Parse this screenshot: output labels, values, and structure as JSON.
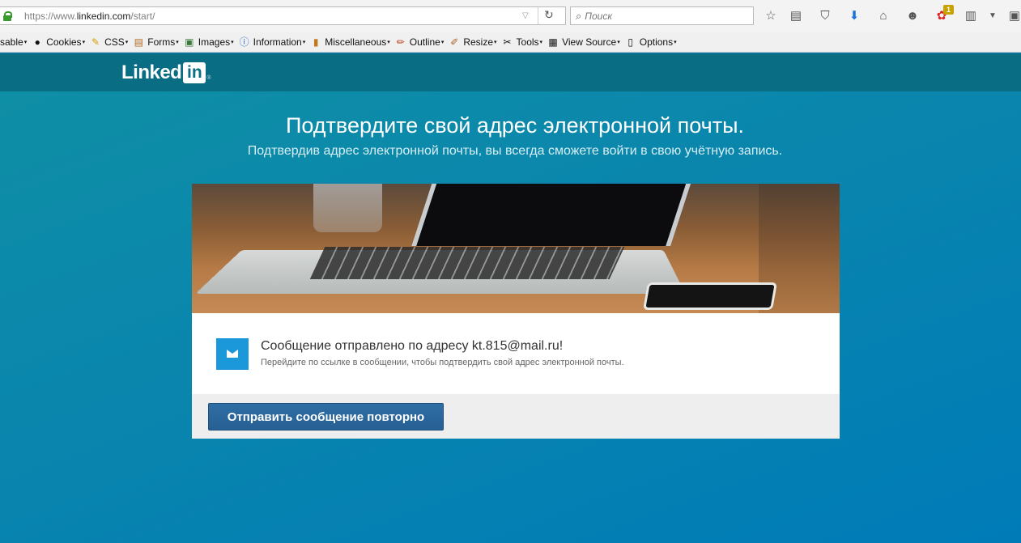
{
  "browser": {
    "url_prefix": "https://www.",
    "url_domain": "linkedin.com",
    "url_path": "/start/",
    "search_placeholder": "Поиск",
    "notification_count": "1"
  },
  "devbar": {
    "items": [
      {
        "label": "sable",
        "icon": "disable-icon"
      },
      {
        "label": "Cookies",
        "icon": "cookies-icon"
      },
      {
        "label": "CSS",
        "icon": "css-icon"
      },
      {
        "label": "Forms",
        "icon": "forms-icon"
      },
      {
        "label": "Images",
        "icon": "images-icon"
      },
      {
        "label": "Information",
        "icon": "information-icon"
      },
      {
        "label": "Miscellaneous",
        "icon": "miscellaneous-icon"
      },
      {
        "label": "Outline",
        "icon": "outline-icon"
      },
      {
        "label": "Resize",
        "icon": "resize-icon"
      },
      {
        "label": "Tools",
        "icon": "tools-icon"
      },
      {
        "label": "View Source",
        "icon": "view-source-icon"
      },
      {
        "label": "Options",
        "icon": "options-icon"
      }
    ]
  },
  "header": {
    "logo_word": "Linked",
    "logo_in": "in",
    "logo_reg": "®"
  },
  "main": {
    "title": "Подтвердите свой адрес электронной почты.",
    "subtitle": "Подтвердив адрес электронной почты, вы всегда сможете войти в свою учётную запись.",
    "message_title": "Сообщение отправлено по адресу kt.815@mail.ru!",
    "message_subtitle": "Перейдите по ссылке в сообщении, чтобы подтвердить свой адрес электронной почты.",
    "resend_label": "Отправить сообщение повторно"
  },
  "colors": {
    "brand": "#096e84",
    "background": "#007cb6",
    "button": "#2c6aa0",
    "mail_icon": "#1a98da"
  }
}
